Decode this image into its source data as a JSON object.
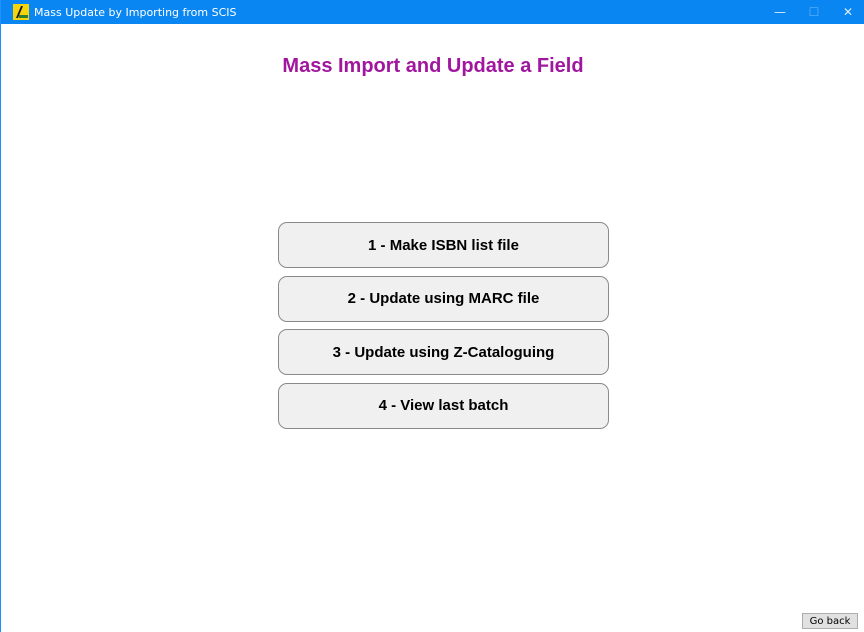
{
  "window": {
    "title": "Mass Update by Importing from SCIS",
    "controls": {
      "minimize": "—",
      "maximize": "☐",
      "close": "✕"
    }
  },
  "page": {
    "title": "Mass Import and Update a Field"
  },
  "menu": {
    "items": [
      {
        "label": "1 - Make ISBN list file"
      },
      {
        "label": "2 - Update using MARC file"
      },
      {
        "label": "3 - Update using Z-Cataloguing"
      },
      {
        "label": "4 - View last batch"
      }
    ]
  },
  "footer": {
    "go_back_label": "Go back"
  },
  "colors": {
    "titlebar": "#0a86f2",
    "page_title": "#a0169f",
    "button_bg": "#f0f0f0"
  },
  "icons": {
    "app": "app-logo-icon"
  }
}
